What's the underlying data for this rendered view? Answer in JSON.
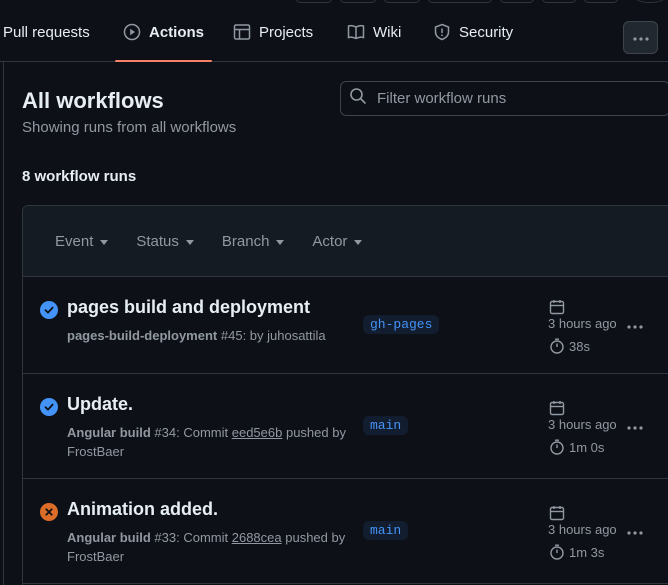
{
  "nav": {
    "tabs": [
      {
        "label": "Pull requests",
        "icon": "pull-request-icon"
      },
      {
        "label": "Actions",
        "icon": "play-icon",
        "active": true
      },
      {
        "label": "Projects",
        "icon": "table-icon"
      },
      {
        "label": "Wiki",
        "icon": "book-icon"
      },
      {
        "label": "Security",
        "icon": "shield-icon"
      }
    ],
    "more_icon": "kebab-horizontal-icon"
  },
  "page": {
    "title": "All workflows",
    "subtitle": "Showing runs from all workflows",
    "runs_count": "8 workflow runs"
  },
  "filter": {
    "placeholder": "Filter workflow runs"
  },
  "filters": [
    "Event",
    "Status",
    "Branch",
    "Actor"
  ],
  "runs": [
    {
      "status": "success",
      "title": "pages build and deployment",
      "workflow": "pages-build-deployment",
      "number": "#45",
      "detail": ": by juhosattila",
      "branch": "gh-pages",
      "when": "3 hours ago",
      "duration": "38s"
    },
    {
      "status": "success",
      "title": "Update.",
      "workflow": "Angular build",
      "number": "#34",
      "detail_pre": ": Commit ",
      "sha": "eed5e6b",
      "detail_post": " pushed by FrostBaer",
      "branch": "main",
      "when": "3 hours ago",
      "duration": "1m 0s"
    },
    {
      "status": "failure",
      "title": "Animation added.",
      "workflow": "Angular build",
      "number": "#33",
      "detail_pre": ": Commit ",
      "sha": "2688cea",
      "detail_post": " pushed by FrostBaer",
      "branch": "main",
      "when": "3 hours ago",
      "duration": "1m 3s"
    }
  ],
  "colors": {
    "bg": "#0d1117",
    "accent_underline": "#f78166",
    "success": "#4493f8",
    "failure": "#db6d28",
    "muted": "#9198a1"
  }
}
